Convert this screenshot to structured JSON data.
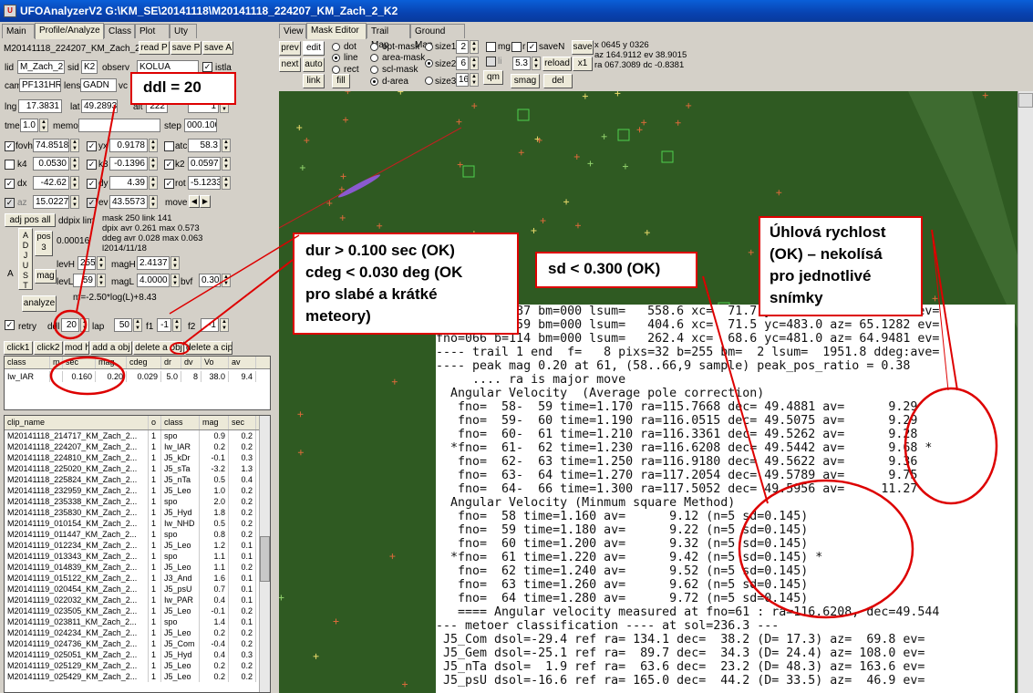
{
  "window": {
    "title": "UFOAnalyzerV2 G:\\KM_SE\\20141118\\M20141118_224207_KM_Zach_2_K2",
    "icon": "ufo-app-icon"
  },
  "left_tabs": [
    "Main",
    "Profile/Analyze",
    "Class",
    "Plot",
    "Uty"
  ],
  "right_tabs": [
    "View",
    "Mask Editor",
    "Trail Map",
    "Ground Map"
  ],
  "profile": {
    "clip_name": "M20141118_224207_KM_Zach_2",
    "read_btn": "read P",
    "save_p_btn": "save P",
    "save_a_btn": "save A",
    "lid_label": "lid",
    "lid": "M_Zach_2",
    "sid_label": "sid",
    "sid": "K2",
    "observer_label": "observ",
    "observer": "KOLUA",
    "istl_label": "istla",
    "cam_label": "cam",
    "cam": "PF131HR",
    "lens_label": "lens",
    "lens": "GADN",
    "vc_label": "vc",
    "lng_label": "lng",
    "lng": "17.3831",
    "lat_label": "lat",
    "lat": "49.2893",
    "alt_label": "alt",
    "alt_val": "222",
    "tz_val": "1",
    "tme_label": "tme",
    "tme": "1.0",
    "memo_label": "memo",
    "step_label": "step",
    "step": "000.100",
    "fovh_label": "fovh",
    "fovh": "74.8518",
    "yx_label": "yx",
    "yx": "0.9178",
    "atc_label": "atc",
    "atc": "58.3",
    "k4_label": "k4",
    "k4": "0.0530",
    "k3_label": "k3",
    "k3": "-0.1396",
    "k2_label": "k2",
    "k2": "0.0597",
    "dx_label": "dx",
    "dx": "-42.62",
    "dy_label": "dy",
    "dy": "4.39",
    "rot_label": "rot",
    "rot": "-5.1233",
    "az_label": "az",
    "az": "15.0227",
    "ev_label": "ev",
    "ev": "43.5573",
    "move_label": "move",
    "adj_pos_all": "adj pos all",
    "ddpix_label": "ddpix lim",
    "mask_info": [
      "mask 250  link 141",
      "dpix avr  0.261 max  0.573",
      "ddeg avr  0.028 max  0.063",
      "l2014/11/18"
    ],
    "adjust_label": "A\nD\nJ\nU\nS\nT",
    "pos3": "pos\n3",
    "pos_val": "0.00016",
    "a_label": "A",
    "levH_label": "levH",
    "levH": "255",
    "magH_label": "magH",
    "magH": "2.4137",
    "mag_btn": "mag",
    "levL_label": "levL",
    "levL": "59",
    "magL_label": "magL",
    "magL": "4.0000",
    "bvf_label": "bvf",
    "bvf": "0.30",
    "analyze_btn": "analyze",
    "formula": "m=-2.50*log(L)+8.43",
    "retry_label": "retry",
    "ddl_label": "ddl",
    "ddl": "20",
    "lap_label": "lap",
    "lap": "50",
    "f1_label": "f1",
    "f1": "-1",
    "f2_label": "f2",
    "f2": "-1"
  },
  "action_buttons": [
    "click1",
    "click2",
    "mod h",
    "add a obj",
    "delete a obj",
    "delete a cip"
  ],
  "result_grid": {
    "headers": [
      "class",
      "m",
      "sec",
      "mag",
      "cdeg",
      "dr",
      "dv",
      "Vo",
      "av"
    ],
    "rows": [
      [
        "Iw_IAR",
        "",
        "0.160",
        "0.20",
        "0.029",
        "5.0",
        "8",
        "38.0",
        "9.4"
      ]
    ]
  },
  "clip_list": {
    "headers": [
      "clip_name",
      "o",
      "class",
      "mag",
      "sec"
    ],
    "rows": [
      [
        "M20141118_214717_KM_Zach_2...",
        "1",
        "spo",
        "0.9",
        "0.2"
      ],
      [
        "M20141118_224207_KM_Zach_2...",
        "1",
        "Iw_IAR",
        "0.2",
        "0.2"
      ],
      [
        "M20141118_224810_KM_Zach_2...",
        "1",
        "J5_kDr",
        "-0.1",
        "0.3"
      ],
      [
        "M20141118_225020_KM_Zach_2...",
        "1",
        "J5_sTa",
        "-3.2",
        "1.3"
      ],
      [
        "M20141118_225824_KM_Zach_2...",
        "1",
        "J5_nTa",
        "0.5",
        "0.4"
      ],
      [
        "M20141118_232959_KM_Zach_2...",
        "1",
        "J5_Leo",
        "1.0",
        "0.2"
      ],
      [
        "M20141118_235338_KM_Zach_2...",
        "1",
        "spo",
        "2.0",
        "0.2"
      ],
      [
        "M20141118_235830_KM_Zach_2...",
        "1",
        "J5_Hyd",
        "1.8",
        "0.2"
      ],
      [
        "M20141119_010154_KM_Zach_2...",
        "1",
        "Iw_NHD",
        "0.5",
        "0.2"
      ],
      [
        "M20141119_011447_KM_Zach_2...",
        "1",
        "spo",
        "0.8",
        "0.2"
      ],
      [
        "M20141119_012234_KM_Zach_2...",
        "1",
        "J5_Leo",
        "1.2",
        "0.1"
      ],
      [
        "M20141119_013343_KM_Zach_2...",
        "1",
        "spo",
        "1.1",
        "0.1"
      ],
      [
        "M20141119_014839_KM_Zach_2...",
        "1",
        "J5_Leo",
        "1.1",
        "0.2"
      ],
      [
        "M20141119_015122_KM_Zach_2...",
        "1",
        "J3_And",
        "1.6",
        "0.1"
      ],
      [
        "M20141119_020454_KM_Zach_2...",
        "1",
        "J5_psU",
        "0.7",
        "0.1"
      ],
      [
        "M20141119_022032_KM_Zach_2...",
        "1",
        "Iw_PAR",
        "0.4",
        "0.1"
      ],
      [
        "M20141119_023505_KM_Zach_2...",
        "1",
        "J5_Leo",
        "-0.1",
        "0.2"
      ],
      [
        "M20141119_023811_KM_Zach_2...",
        "1",
        "spo",
        "1.4",
        "0.1"
      ],
      [
        "M20141119_024234_KM_Zach_2...",
        "1",
        "J5_Leo",
        "0.2",
        "0.2"
      ],
      [
        "M20141119_024736_KM_Zach_2...",
        "1",
        "J5_Com",
        "-0.4",
        "0.2"
      ],
      [
        "M20141119_025051_KM_Zach_2...",
        "1",
        "J5_Hyd",
        "0.4",
        "0.3"
      ],
      [
        "M20141119_025129_KM_Zach_2...",
        "1",
        "J5_Leo",
        "0.2",
        "0.2"
      ],
      [
        "M20141119_025429_KM_Zach_2...",
        "1",
        "J5_Leo",
        "0.2",
        "0.2"
      ]
    ]
  },
  "mask_toolbar": {
    "prev": "prev",
    "edit": "edit",
    "next": "next",
    "auto": "auto",
    "link": "link",
    "fill": "fill",
    "dot": "dot",
    "line": "line",
    "rect": "rect",
    "area": "d-area",
    "opt_mask": "opt-mask",
    "area_mask": "area-mask",
    "scl_mask": "scl-mask",
    "d_area": "d-area",
    "size1_label": "size1",
    "size1": "2",
    "size2_label": "size2",
    "size2": "6",
    "size3_label": "size3",
    "size3": "16",
    "qm": "qm",
    "mg": "mg",
    "r": "r",
    "saveN": "saveN",
    "save": "save",
    "li": "li",
    "val": "5.3",
    "reload": "reload",
    "x1": "x1",
    "smag": "smag",
    "del": "del",
    "coords": [
      "x 0645  y 0326",
      "az 164.9112 ev 38.9015",
      "ra 067.3089 dc -0.8381"
    ]
  },
  "console_lines": [
    "fno=064 b=187 bm=000 lsum=   558.6 xc=  71.7 yc=483.5 az= 65.3267 ev=",
    "fno=065 b=159 bm=000 lsum=   404.6 xc=  71.5 yc=483.0 az= 65.1282 ev=",
    "fno=066 b=114 bm=000 lsum=   262.4 xc=  68.6 yc=481.0 az= 64.9481 ev=",
    "---- trail 1 end  f=   8 pixs=32 b=255 bm=  2 lsum=  1951.8 ddeg:ave=",
    "---- peak mag 0.20 at 61, (58..66,9 sample) peak_pos_ratio = 0.38",
    "     .... ra is major move",
    "  Angular Velocity  (Average pole correction)",
    "   fno=  58-  59 time=1.170 ra=115.7668 dec= 49.4881 av=      9.29",
    "   fno=  59-  60 time=1.190 ra=116.0515 dec= 49.5075 av=      9.29",
    "   fno=  60-  61 time=1.210 ra=116.3361 dec= 49.5262 av=      9.28",
    "  *fno=  61-  62 time=1.230 ra=116.6208 dec= 49.5442 av=      9.68 *",
    "   fno=  62-  63 time=1.250 ra=116.9180 dec= 49.5622 av=      9.36",
    "   fno=  63-  64 time=1.270 ra=117.2054 dec= 49.5789 av=      9.75",
    "   fno=  64-  66 time=1.300 ra=117.5052 dec= 49.5956 av=     11.27",
    "  Angular Velocity (Minmum square Method)",
    "   fno=  58 time=1.160 av=      9.12 (n=5 sd=0.145)",
    "   fno=  59 time=1.180 av=      9.22 (n=5 sd=0.145)",
    "   fno=  60 time=1.200 av=      9.32 (n=5 sd=0.145)",
    "  *fno=  61 time=1.220 av=      9.42 (n=5 sd=0.145) *",
    "   fno=  62 time=1.240 av=      9.52 (n=5 sd=0.145)",
    "   fno=  63 time=1.260 av=      9.62 (n=5 sd=0.145)",
    "   fno=  64 time=1.280 av=      9.72 (n=5 sd=0.145)",
    "   ==== Angular velocity measured at fno=61 : ra=116.6208, dec=49.544",
    "--- metoer classification ---- at sol=236.3 ---",
    " J5_Com dsol=-29.4 ref ra= 134.1 dec=  38.2 (D= 17.3) az=  69.8 ev=",
    " J5_Gem dsol=-25.1 ref ra=  89.7 dec=  34.3 (D= 24.4) az= 108.0 ev=",
    " J5_nTa dsol=  1.9 ref ra=  63.6 dec=  23.2 (D= 48.3) az= 163.6 ev=",
    " J5_psU dsol=-16.6 ref ra= 165.0 dec=  44.2 (D= 33.5) az=  46.9 ev="
  ],
  "annotations": {
    "ddl": "ddl = 20",
    "dur": [
      "dur > 0.100 sec (OK)",
      "cdeg < 0.030 deg (OK",
      "pro slabé a krátké",
      "meteory)"
    ],
    "sd": "sd < 0.300 (OK)",
    "av": [
      "Úhlová rychlost",
      "(OK) – nekolísá",
      "pro jednotlivé",
      "snímky"
    ]
  },
  "colors": {
    "annotation": "#dd0000",
    "sky": "#2f5a22",
    "titlebar": "#0a5fd8"
  }
}
